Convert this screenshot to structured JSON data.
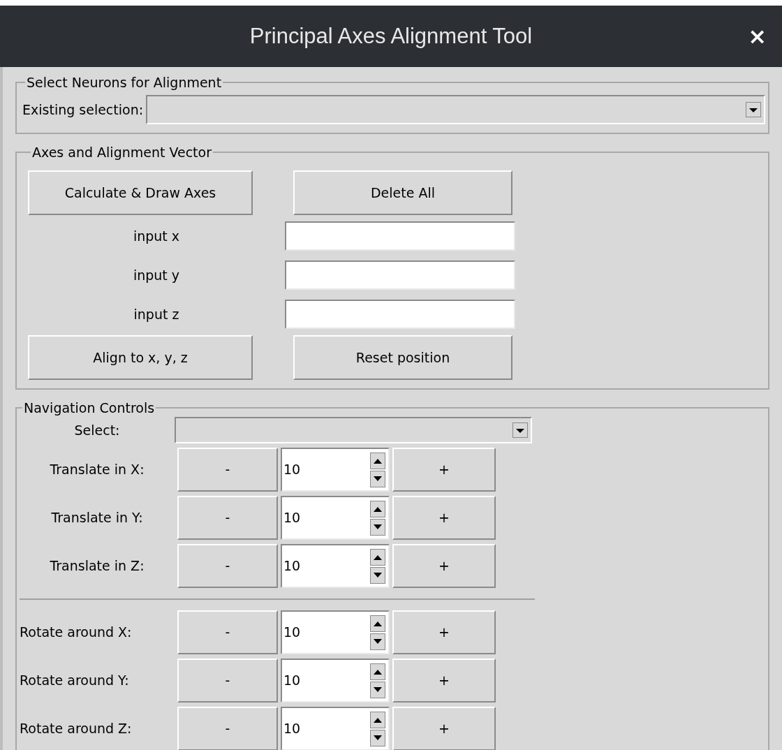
{
  "window": {
    "title": "Principal Axes Alignment Tool",
    "close": "×"
  },
  "select_neurons": {
    "legend": "Select Neurons for Alignment",
    "label": "Existing selection:"
  },
  "axes": {
    "legend": "Axes and Alignment Vector",
    "top_buttons": [
      "Calculate & Draw Axes",
      "Delete All"
    ],
    "inputs": [
      {
        "label": "input x"
      },
      {
        "label": "input y"
      },
      {
        "label": "input z"
      }
    ],
    "bottom_buttons": [
      "Align to x, y, z",
      "Reset position"
    ]
  },
  "navigation": {
    "legend": "Navigation Controls",
    "select_label": "Select:",
    "groups": [
      [
        {
          "label": "Translate in X:",
          "minus": "-",
          "value": "10",
          "plus": "+"
        },
        {
          "label": "Translate in Y:",
          "minus": "-",
          "value": "10",
          "plus": "+"
        },
        {
          "label": "Translate in Z:",
          "minus": "-",
          "value": "10",
          "plus": "+"
        }
      ],
      [
        {
          "label": "Rotate around X:",
          "minus": "-",
          "value": "10",
          "plus": "+"
        },
        {
          "label": "Rotate around Y:",
          "minus": "-",
          "value": "10",
          "plus": "+"
        },
        {
          "label": "Rotate around Z:",
          "minus": "-",
          "value": "10",
          "plus": "+"
        }
      ]
    ]
  }
}
